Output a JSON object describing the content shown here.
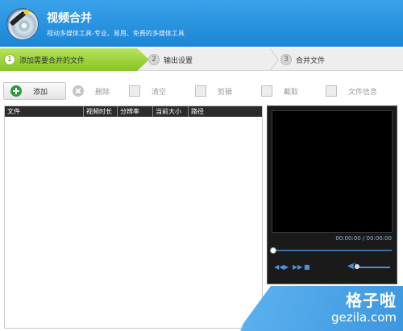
{
  "header": {
    "title": "视频合并",
    "subtitle": "视动多媒体工具-专业、易用、免费的多媒体工具"
  },
  "steps": [
    {
      "num": "1",
      "label": "添加需要合并的文件",
      "active": true
    },
    {
      "num": "2",
      "label": "输出设置",
      "active": false
    },
    {
      "num": "3",
      "label": "合并文件",
      "active": false
    }
  ],
  "toolbar": {
    "add": "添加",
    "delete": "删除",
    "clear": "清空",
    "clip": "剪辑",
    "crop": "截取",
    "info": "文件信息"
  },
  "file_list": {
    "columns": [
      "文件",
      "视频时长",
      "分辨率",
      "当前大小",
      "路径"
    ]
  },
  "player": {
    "time": "00:00:00 / 00:00:00",
    "prev": "◀◀",
    "play": "▶",
    "next": "▶▶",
    "stop": "■",
    "volume_icon": "◀)",
    "progress": 0,
    "volume": 0
  },
  "watermark": {
    "cn": "格子啦",
    "en": "gezila.com"
  },
  "colors": {
    "header": "#2a93e0",
    "step_active": "#9ccf3a",
    "player_accent": "#4c8fd6"
  }
}
